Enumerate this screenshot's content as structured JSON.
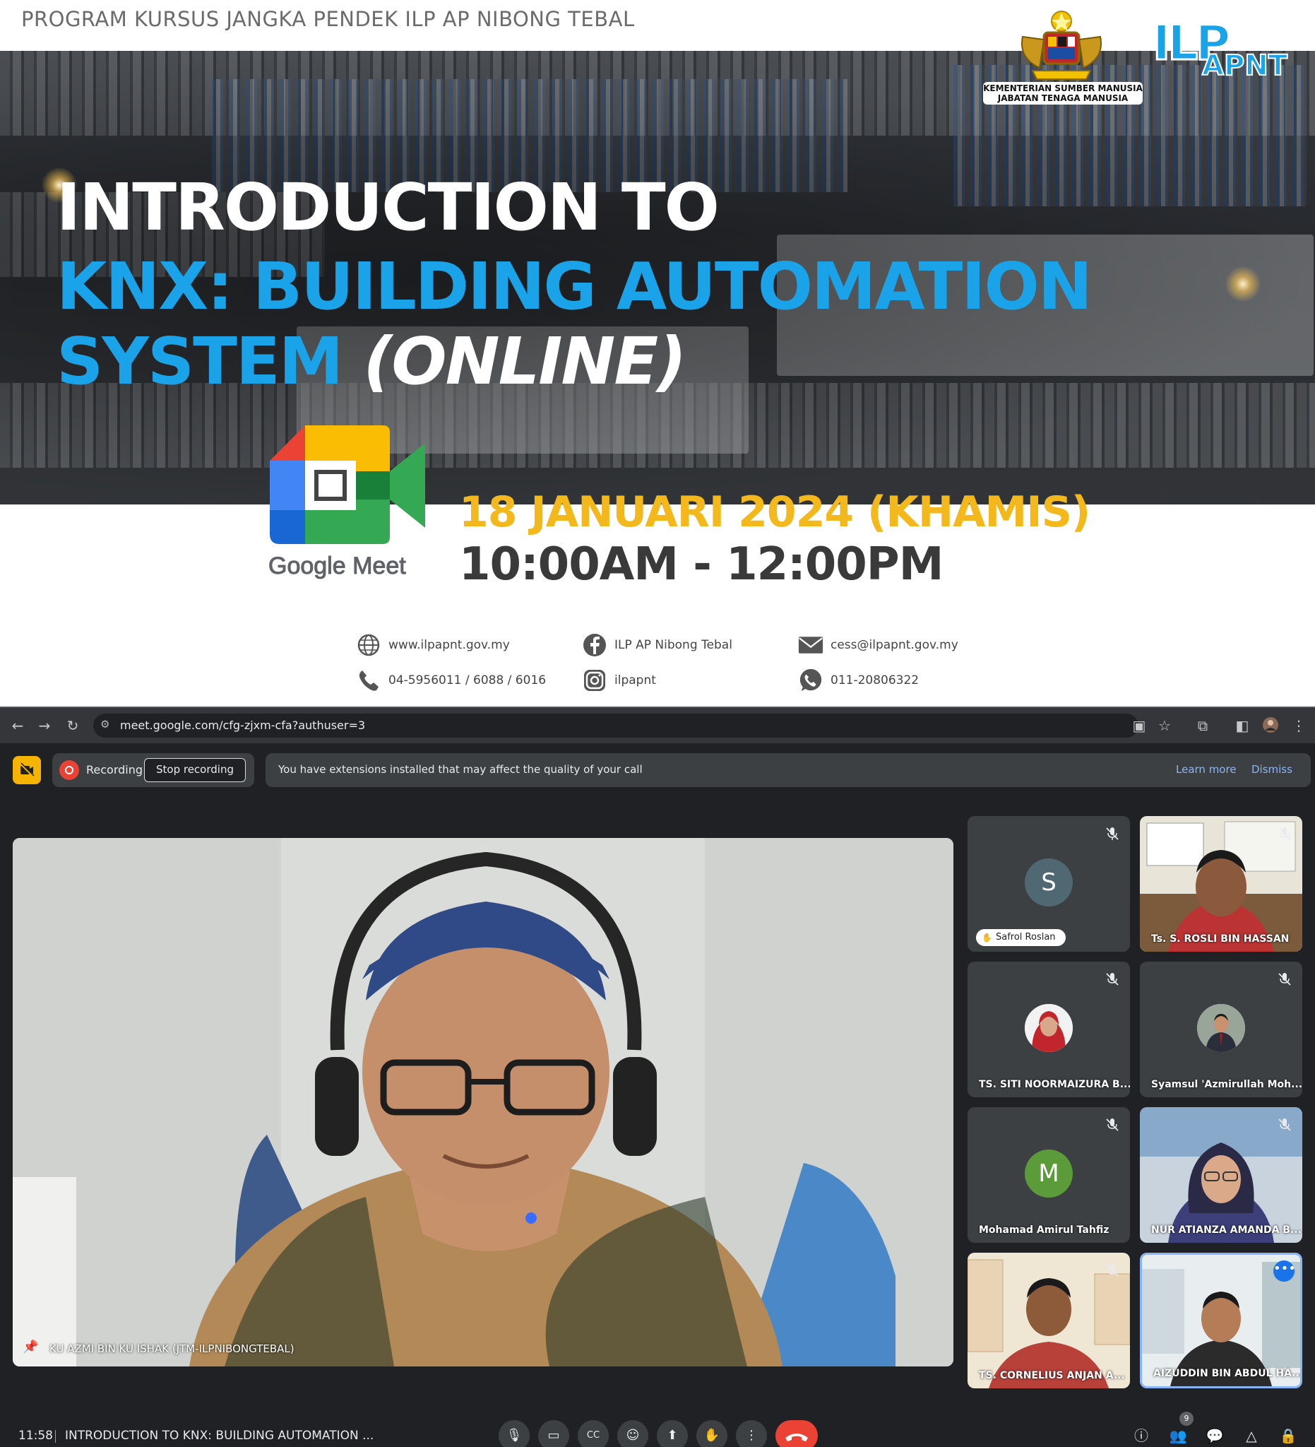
{
  "poster": {
    "program": "PROGRAM KURSUS JANGKA PENDEK ILP AP NIBONG TEBAL",
    "title_line1": "INTRODUCTION TO",
    "title_line2": "KNX: BUILDING AUTOMATION",
    "title_line3": "SYSTEM",
    "title_line3_suffix": "(ONLINE)",
    "date": "18 JANUARI 2024 (KHAMIS)",
    "time": "10:00AM - 12:00PM",
    "ministry_line1": "KEMENTERIAN SUMBER MANUSIA",
    "ministry_line2": "JABATAN TENAGA MANUSIA",
    "ilp_logo_text": "ILP",
    "ilp_logo_sub": "APNT",
    "meet_logo_text": "Google Meet",
    "contacts": {
      "website": "www.ilpapnt.gov.my",
      "facebook": "ILP AP Nibong Tebal",
      "email": "cess@ilpapnt.gov.my",
      "phone": "04-5956011 / 6088 / 6016",
      "instagram": "ilpapnt",
      "whatsapp": "011-20806322"
    },
    "colors": {
      "accent_blue": "#1aa3e8",
      "accent_yellow": "#f3b81b"
    }
  },
  "browser": {
    "url": "meet.google.com/cfg-zjxm-cfa?authuser=3"
  },
  "meet": {
    "recording_label": "Recording",
    "stop_recording": "Stop recording",
    "extension_warning": "You have extensions installed that may affect the quality of your call",
    "learn_more": "Learn more",
    "dismiss": "Dismiss",
    "main_speaker": "KU AZMI BIN KU ISHAK (JTM-ILPNIBONGTEBAL)",
    "participants": [
      {
        "name": "Safrol Roslan",
        "initial": "S",
        "color": "#4f6872"
      },
      {
        "name": "Ts. S. ROSLI BIN HASSAN"
      },
      {
        "name": "TS. SITI NOORMAIZURA B..."
      },
      {
        "name": "Syamsul 'Azmirullah Moh..."
      },
      {
        "name": "Mohamad Amirul Tahfiz",
        "initial": "M",
        "color": "#5c9b3a"
      },
      {
        "name": "NUR ATIANZA AMANDA B..."
      },
      {
        "name": "TS. CORNELIUS ANJAN A..."
      },
      {
        "name": "AIZUDDIN BIN ABDUL HA..."
      }
    ],
    "clock": "11:58",
    "meeting_title": "INTRODUCTION TO KNX: BUILDING AUTOMATION ...",
    "people_count": "9"
  }
}
